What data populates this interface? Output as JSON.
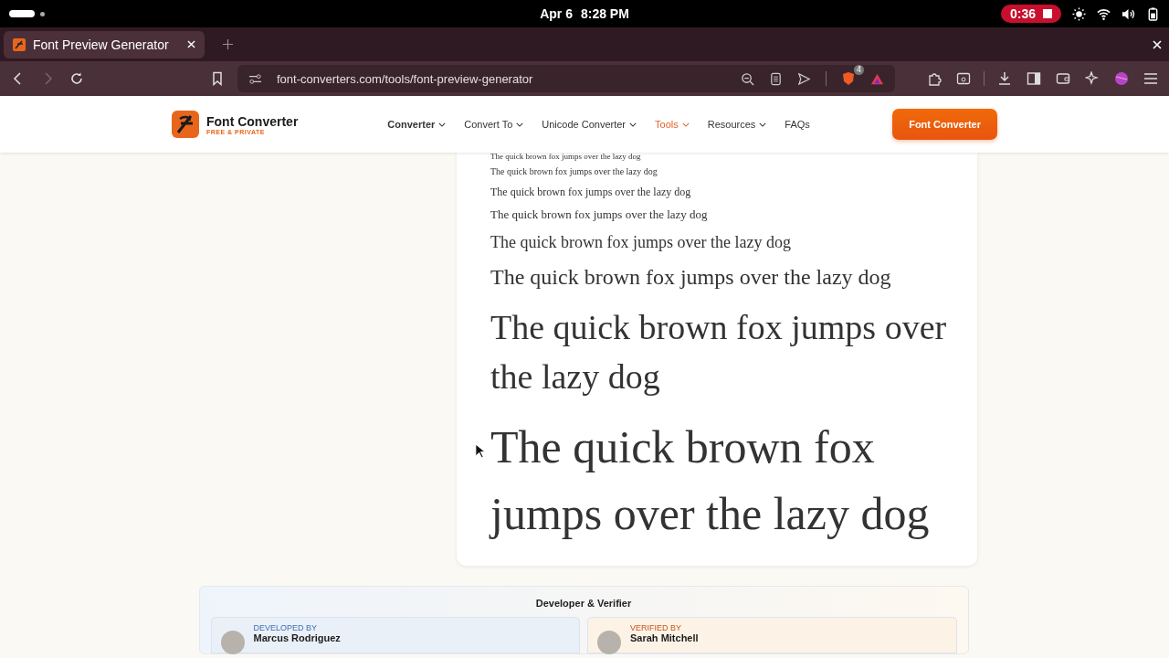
{
  "status_bar": {
    "date": "Apr 6",
    "time": "8:28 PM",
    "recording": "0:36"
  },
  "browser": {
    "tab": {
      "title": "Font Preview Generator",
      "selected": true
    },
    "address": "font-converters.com/tools/font-preview-generator",
    "shield_count": "4"
  },
  "site_header": {
    "logo_title": "Font Converter",
    "logo_subtitle": "FREE & PRIVATE",
    "nav": [
      {
        "label": "Converter",
        "selected": false,
        "dropdown": true
      },
      {
        "label": "Convert To",
        "selected": false,
        "dropdown": true
      },
      {
        "label": "Unicode Converter",
        "selected": false,
        "dropdown": true
      },
      {
        "label": "Tools",
        "selected": true,
        "dropdown": true
      },
      {
        "label": "Resources",
        "selected": false,
        "dropdown": true
      },
      {
        "label": "FAQs",
        "selected": false,
        "dropdown": false
      }
    ],
    "cta": "Font Converter"
  },
  "preview": {
    "lines": [
      "The quick brown fox jumps over the lazy dog",
      "The quick brown fox jumps over the lazy dog",
      "The quick brown fox jumps over the lazy dog",
      "The quick brown fox jumps over the lazy dog",
      "The quick brown fox jumps over the lazy dog",
      "The quick brown fox jumps over the lazy dog",
      "The quick brown fox jumps over the lazy dog",
      "The quick brown fox jumps over the lazy dog"
    ]
  },
  "credits": {
    "title": "Developer & Verifier",
    "people": [
      {
        "kind": "developer",
        "role": "DEVELOPED BY",
        "name": "Marcus Rodriguez"
      },
      {
        "kind": "verifier",
        "role": "VERIFIED BY",
        "name": "Sarah Mitchell"
      }
    ]
  }
}
